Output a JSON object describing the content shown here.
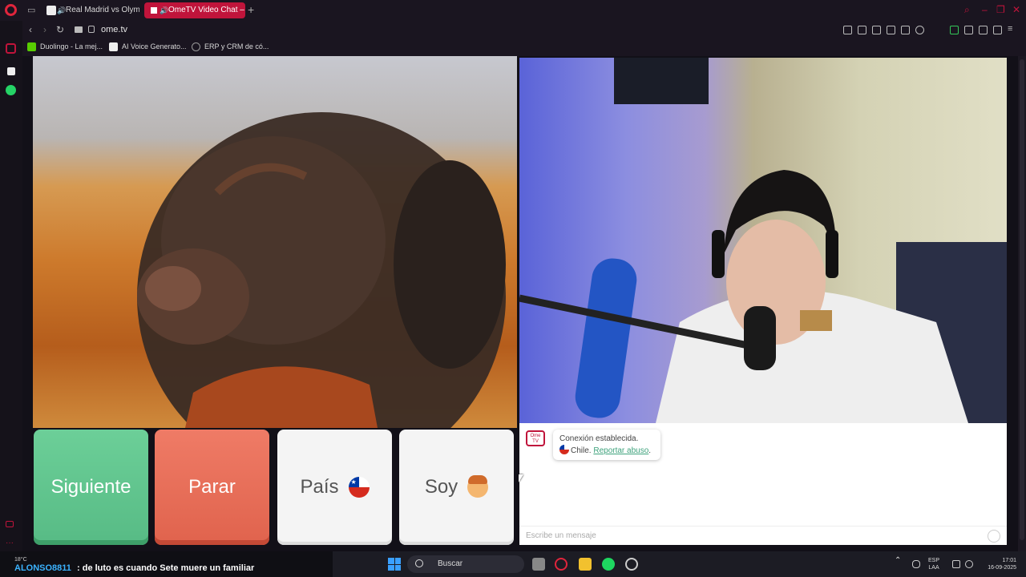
{
  "browser": {
    "tabs": [
      {
        "title": "Real Madrid vs Olymp"
      },
      {
        "title": "OmeTV Video Chat –"
      }
    ],
    "new_tab_icon": "+",
    "url": "ome.tv",
    "bookmarks": [
      {
        "label": "Duolingo - La mej..."
      },
      {
        "label": "AI Voice Generato..."
      },
      {
        "label": "ERP y CRM de có..."
      }
    ],
    "accent_color": "#c0143b"
  },
  "controls": {
    "next_label": "Siguiente",
    "stop_label": "Parar",
    "country_label": "País",
    "gender_label": "Soy"
  },
  "chat": {
    "logo_text": "Ome TV",
    "status_message": "Conexión establecida.",
    "country": "Chile.",
    "report_link": "Reportar abuso",
    "report_suffix": ".",
    "input_placeholder": "Escribe un mensaje"
  },
  "taskbar": {
    "weather": "18°C",
    "ticker_user": "ALONSO8811",
    "ticker_message": ": de luto es cuando Sete muere un familiar",
    "search_label": "Buscar",
    "language_line1": "ESP",
    "language_line2": "LAA",
    "time": "17:01",
    "date": "16-09-2025"
  }
}
